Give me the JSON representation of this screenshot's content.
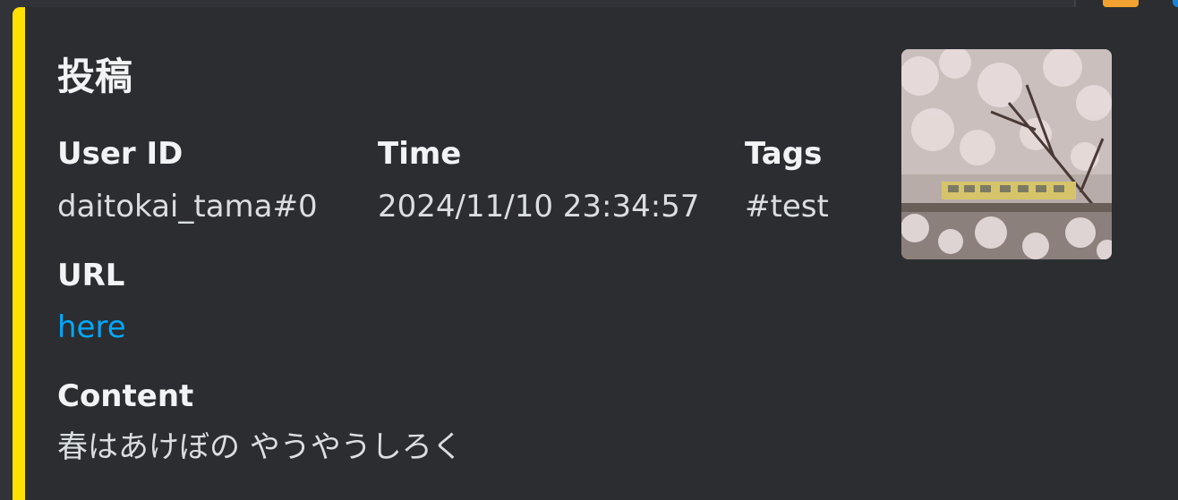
{
  "embed": {
    "accent_color": "#fee001",
    "title": "投稿",
    "fields": {
      "user_id": {
        "name": "User ID",
        "value": "daitokai_tama#0"
      },
      "time": {
        "name": "Time",
        "value": "2024/11/10 23:34:57"
      },
      "tags": {
        "name": "Tags",
        "value": "#test"
      },
      "url": {
        "name": "URL",
        "value": "here"
      },
      "content": {
        "name": "Content",
        "value": "春はあけぼの やうやうしろく"
      }
    },
    "thumbnail_icon": "cherry-blossom-train-photo"
  },
  "colors": {
    "background": "#2b2d31",
    "link": "#00a8fc",
    "heading": "#f2f3f5",
    "text": "#dbdee1"
  }
}
